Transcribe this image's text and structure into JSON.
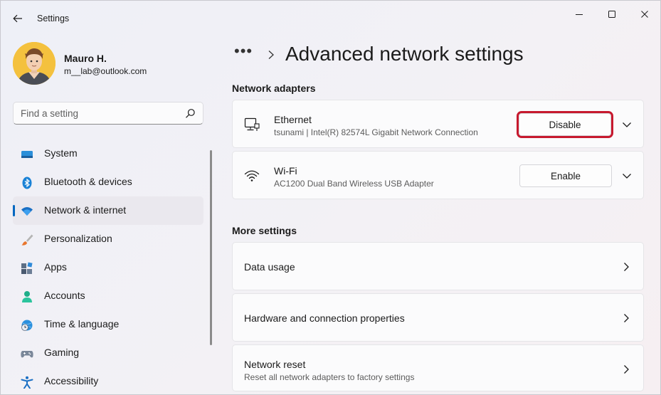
{
  "app": {
    "title": "Settings"
  },
  "user": {
    "name": "Mauro H.",
    "email": "m__lab@outlook.com"
  },
  "search": {
    "placeholder": "Find a setting",
    "value": ""
  },
  "sidebar": {
    "items": [
      {
        "label": "System",
        "icon": "system-icon"
      },
      {
        "label": "Bluetooth & devices",
        "icon": "bluetooth-icon"
      },
      {
        "label": "Network & internet",
        "icon": "wifi-icon",
        "active": true
      },
      {
        "label": "Personalization",
        "icon": "brush-icon"
      },
      {
        "label": "Apps",
        "icon": "apps-icon"
      },
      {
        "label": "Accounts",
        "icon": "person-icon"
      },
      {
        "label": "Time & language",
        "icon": "clock-globe-icon"
      },
      {
        "label": "Gaming",
        "icon": "gamepad-icon"
      },
      {
        "label": "Accessibility",
        "icon": "accessibility-icon"
      }
    ]
  },
  "breadcrumb": {
    "ellipsis": "•••"
  },
  "page": {
    "title": "Advanced network settings"
  },
  "network_adapters": {
    "title": "Network adapters",
    "adapters": [
      {
        "name": "Ethernet",
        "description": "tsunami | Intel(R) 82574L Gigabit Network Connection",
        "button": "Disable",
        "icon": "ethernet-icon"
      },
      {
        "name": "Wi-Fi",
        "description": "AC1200  Dual Band Wireless USB Adapter",
        "button": "Enable",
        "icon": "wifi-signal-icon"
      }
    ]
  },
  "more_settings": {
    "title": "More settings",
    "items": [
      {
        "label": "Data usage"
      },
      {
        "label": "Hardware and connection properties"
      },
      {
        "label": "Network reset",
        "description": "Reset all network adapters to factory settings"
      }
    ]
  },
  "colors": {
    "accent": "#0067c0",
    "highlight": "#c7192e"
  }
}
